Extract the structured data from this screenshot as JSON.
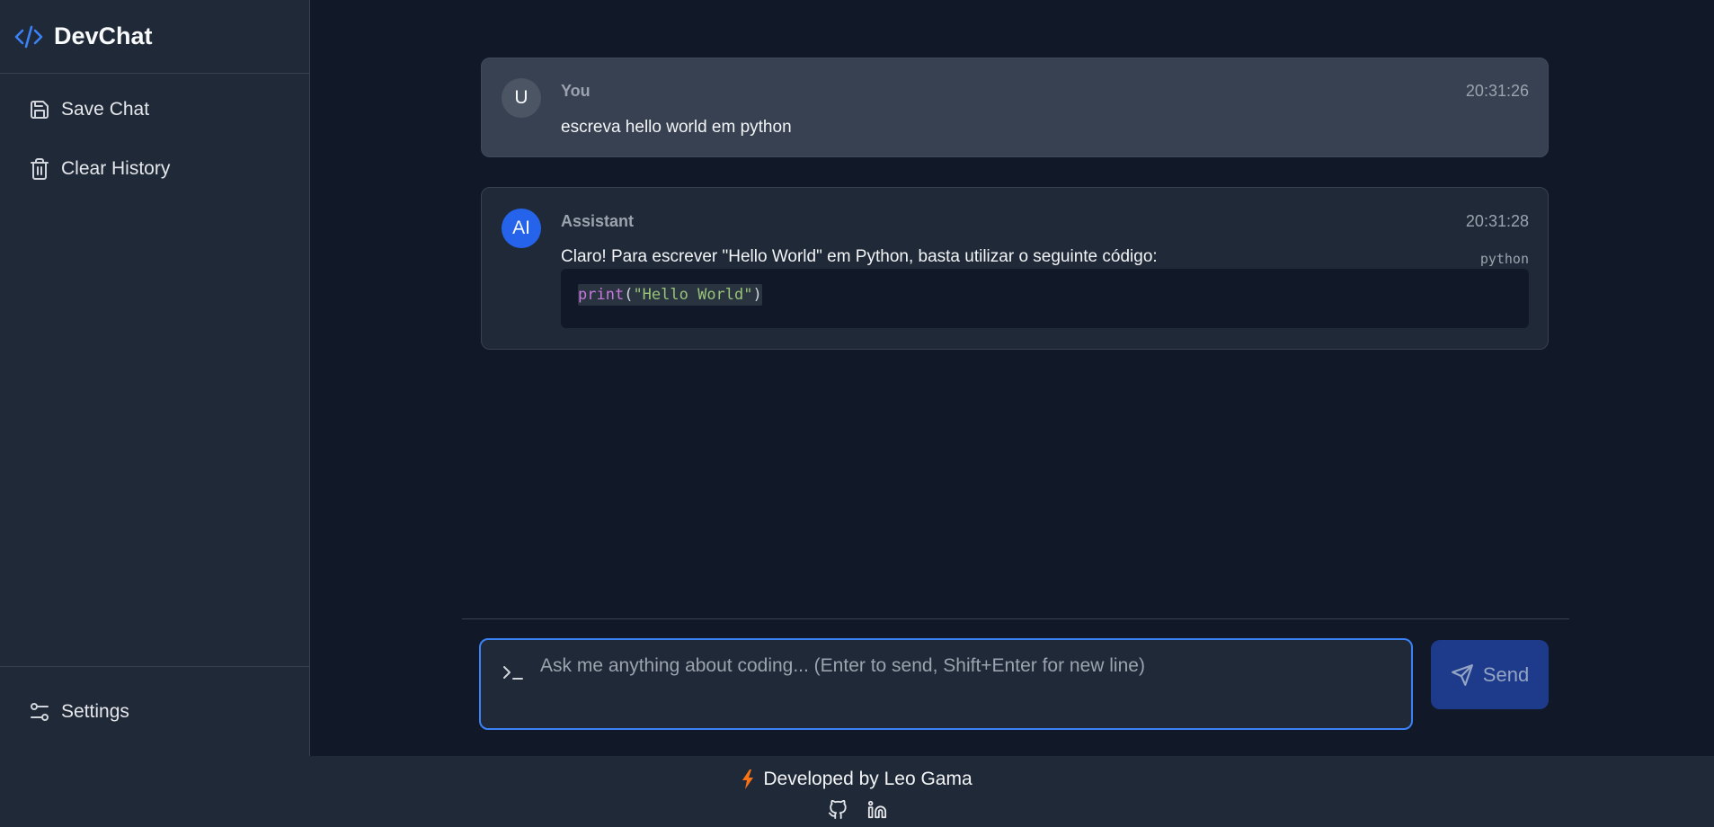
{
  "app": {
    "name": "DevChat",
    "logo_icon": "code-icon",
    "accent": "#3b82f6"
  },
  "sidebar": {
    "items": [
      {
        "label": "Save Chat",
        "icon": "save-icon"
      },
      {
        "label": "Clear History",
        "icon": "trash-icon"
      }
    ],
    "bottom": {
      "label": "Settings",
      "icon": "sliders-icon"
    }
  },
  "messages": [
    {
      "role": "user",
      "avatar": "U",
      "sender": "You",
      "time": "20:31:26",
      "text": "escreva hello world em python"
    },
    {
      "role": "assistant",
      "avatar": "AI",
      "sender": "Assistant",
      "time": "20:31:28",
      "text": "Claro! Para escrever \"Hello World\" em Python, basta utilizar o seguinte código:",
      "code": {
        "language": "python",
        "func": "print",
        "open": "(",
        "string": "\"Hello World\"",
        "close": ")"
      }
    }
  ],
  "composer": {
    "placeholder": "Ask me anything about coding... (Enter to send, Shift+Enter for new line)",
    "value": "",
    "send_label": "Send"
  },
  "footer": {
    "credit": "Developed by Leo Gama",
    "links": [
      "github-icon",
      "linkedin-icon"
    ]
  }
}
